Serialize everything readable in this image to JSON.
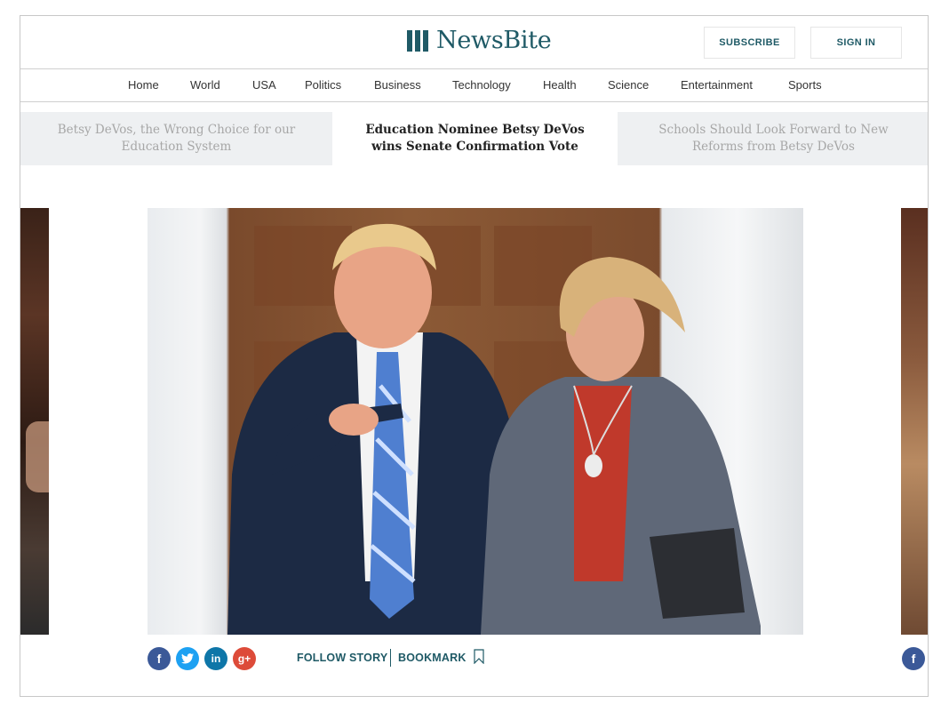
{
  "header": {
    "logo_text": "NewsBite",
    "subscribe_label": "SUBSCRIBE",
    "signin_label": "SIGN IN"
  },
  "nav": {
    "items": [
      "Home",
      "World",
      "USA",
      "Politics",
      "Business",
      "Technology",
      "Health",
      "Science",
      "Entertainment",
      "Sports"
    ]
  },
  "stories": {
    "prev_title": "Betsy DeVos, the Wrong Choice for our Education System",
    "current_title": "Education Nominee Betsy DeVos wins Senate Confirmation Vote",
    "next_title": "Schools Should Look Forward to New Reforms from Betsy DeVos"
  },
  "actions": {
    "follow_label": "FOLLOW STORY",
    "bookmark_label": "BOOKMARK"
  },
  "social": {
    "icons": [
      "facebook-icon",
      "twitter-icon",
      "linkedin-icon",
      "google-plus-icon"
    ]
  },
  "colors": {
    "brand": "#1f5a66",
    "facebook": "#3b5998",
    "twitter": "#1da1f2",
    "linkedin": "#0e76a8",
    "google_plus": "#dd4b39"
  }
}
